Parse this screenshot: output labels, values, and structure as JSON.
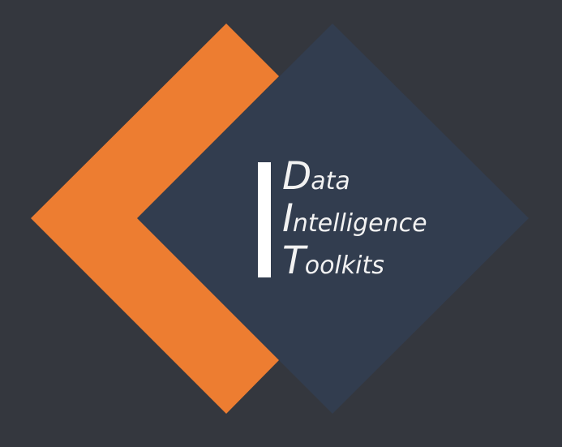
{
  "logo": {
    "lines": [
      {
        "initial": "D",
        "rest": "ata"
      },
      {
        "initial": "I",
        "rest": "ntelligence"
      },
      {
        "initial": "T",
        "rest": "oolkits"
      }
    ]
  },
  "colors": {
    "background": "#34373e",
    "navy_diamond": "#323d4f",
    "orange_chevron": "#ed7d31",
    "bar": "#ffffff",
    "text": "#f2f2f2"
  }
}
